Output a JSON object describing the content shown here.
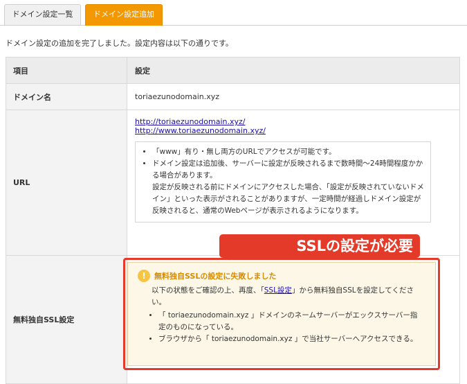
{
  "tabs": {
    "list_label": "ドメイン設定一覧",
    "add_label": "ドメイン設定追加"
  },
  "intro": "ドメイン設定の追加を完了しました。設定内容は以下の通りです。",
  "table": {
    "col_item": "項目",
    "col_setting": "設定",
    "domain_label": "ドメイン名",
    "domain_value": "toriaezunodomain.xyz",
    "url_label": "URL",
    "url_1": "http://toriaezunodomain.xyz/",
    "url_2": "http://www.toriaezunodomain.xyz/",
    "url_notes": [
      "「www」有り・無し両方のURLでアクセスが可能です。",
      "ドメイン設定は追加後、サーバーに設定が反映されるまで数時間〜24時間程度かかる場合があります。",
      "設定が反映される前にドメインにアクセスした場合、「設定が反映されていないドメイン」といった表示がされることがありますが、一定時間が経過しドメイン設定が反映されると、通常のWebページが表示されるようになります。"
    ],
    "ssl_label": "無料独自SSL設定"
  },
  "ssl_card": {
    "icon": "exclamation-icon",
    "title": "無料独自SSLの設定に失敗しました",
    "body_prefix": "以下の状態をご確認の上、再度、「",
    "body_link": "SSL設定",
    "body_suffix": "」から無料独自SSLを設定してください。",
    "items": [
      "「 toriaezunodomain.xyz 」ドメインのネームサーバーがエックスサーバー指定のものになっている。",
      "ブラウザから「 toriaezunodomain.xyz 」で当社サーバーへアクセスできる。"
    ]
  },
  "callout": {
    "text": "SSLの設定が必要",
    "color": "#e43a2a"
  }
}
